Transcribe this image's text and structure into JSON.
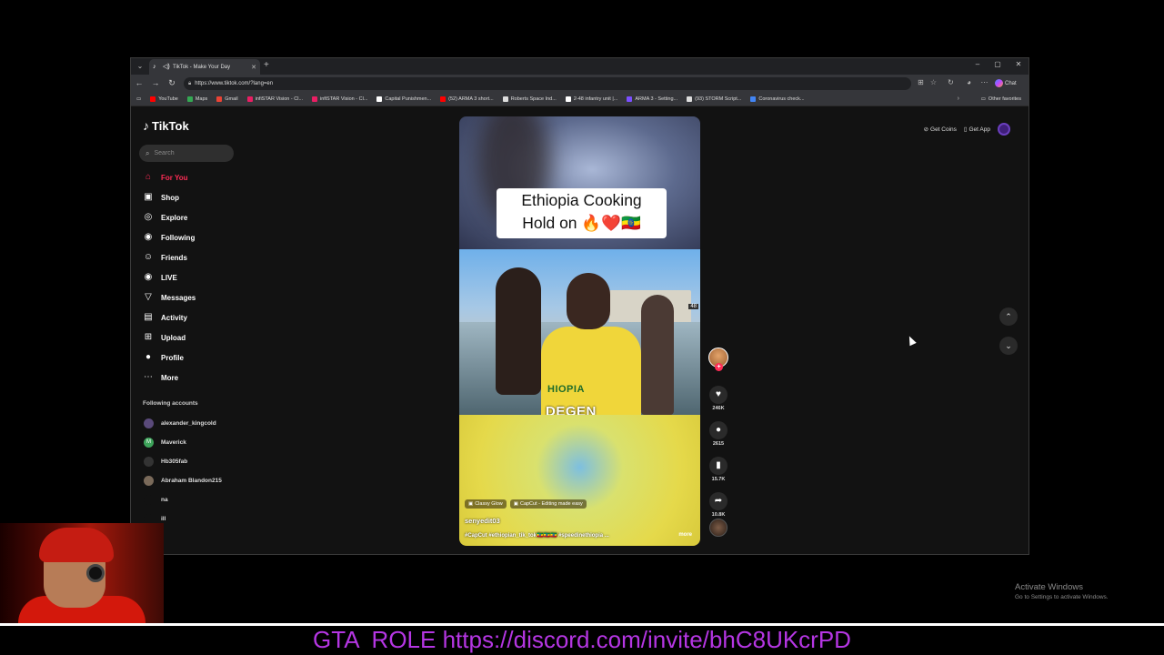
{
  "browser": {
    "tab_title": "TikTok - Make Your Day",
    "url": "https://www.tiktok.com/?lang=en",
    "chat_label": "Chat",
    "bookmarks": [
      {
        "label": "YouTube",
        "color": "#ff0000"
      },
      {
        "label": "Maps",
        "color": "#34a853"
      },
      {
        "label": "Gmail",
        "color": "#ea4335"
      },
      {
        "label": "infiSTAR Vision - Cl...",
        "color": "#e91e63"
      },
      {
        "label": "infiSTAR Vision - Cl...",
        "color": "#e91e63"
      },
      {
        "label": "Capital Punishmen...",
        "color": "#ffffff"
      },
      {
        "label": "(52) ARMA 3 short...",
        "color": "#ff0000"
      },
      {
        "label": "Roberts Space Ind...",
        "color": "#dddddd"
      },
      {
        "label": "2-48 infantry unit |...",
        "color": "#ffffff"
      },
      {
        "label": "ARMA 3 - Setting...",
        "color": "#7b4fff"
      },
      {
        "label": "(93) STORM Script...",
        "color": "#dddddd"
      },
      {
        "label": "Coronavirus check...",
        "color": "#4285f4"
      }
    ],
    "other_favorites": "Other favorites"
  },
  "tiktok": {
    "logo": "TikTok",
    "search_placeholder": "Search",
    "nav": [
      {
        "label": "For You",
        "icon": "home-icon",
        "glyph": "⌂",
        "active": true
      },
      {
        "label": "Shop",
        "icon": "shop-icon",
        "glyph": "▣",
        "active": false
      },
      {
        "label": "Explore",
        "icon": "compass-icon",
        "glyph": "◎",
        "active": false
      },
      {
        "label": "Following",
        "icon": "following-avatar-icon",
        "glyph": "◉",
        "active": false
      },
      {
        "label": "Friends",
        "icon": "friends-icon",
        "glyph": "☺",
        "active": false
      },
      {
        "label": "LIVE",
        "icon": "live-icon",
        "glyph": "◉",
        "active": false
      },
      {
        "label": "Messages",
        "icon": "messages-icon",
        "glyph": "▽",
        "active": false
      },
      {
        "label": "Activity",
        "icon": "activity-icon",
        "glyph": "▤",
        "active": false
      },
      {
        "label": "Upload",
        "icon": "upload-icon",
        "glyph": "⊞",
        "active": false
      },
      {
        "label": "Profile",
        "icon": "profile-icon",
        "glyph": "●",
        "active": false
      },
      {
        "label": "More",
        "icon": "more-icon",
        "glyph": "⋯",
        "active": false
      }
    ],
    "following_title": "Following accounts",
    "following": [
      {
        "name": "alexander_kingcold",
        "color": "#5a4a7a",
        "letter": ""
      },
      {
        "name": "Maverick",
        "color": "#3da35a",
        "letter": "M"
      },
      {
        "name": "Hb305fab",
        "color": "#333333",
        "letter": ""
      },
      {
        "name": "Abraham Blandon215",
        "color": "#7a6a5a",
        "letter": ""
      },
      {
        "name": "na",
        "color": "#121212",
        "letter": ""
      },
      {
        "name": "ill",
        "color": "#121212",
        "letter": ""
      }
    ],
    "get_coins": "Get Coins",
    "get_app": "Get App",
    "video": {
      "caption_line1": "Ethiopia Cooking",
      "caption_line2": "Hold on 🔥❤️🇪🇹",
      "shirt_text": "HIOPIA",
      "watermark": "DEGEN",
      "badge": "48",
      "tag1": "Classy Glow",
      "tag2": "CapCut - Editing made easy",
      "author": "senyedit03",
      "description": "#CapCut #ethiopian_tik_tok🇪🇹🇪🇹🇪🇹 #speedinethiopia ...",
      "more": "more"
    },
    "actions": {
      "likes": "246K",
      "comments": "2615",
      "saves": "15.7K",
      "shares": "10.8K"
    }
  },
  "desktop": {
    "activate_title": "Activate Windows",
    "activate_sub": "Go to Settings to activate Windows.",
    "banner": "GTA  ROLE https://discord.com/invite/bhC8UKcrPD"
  }
}
